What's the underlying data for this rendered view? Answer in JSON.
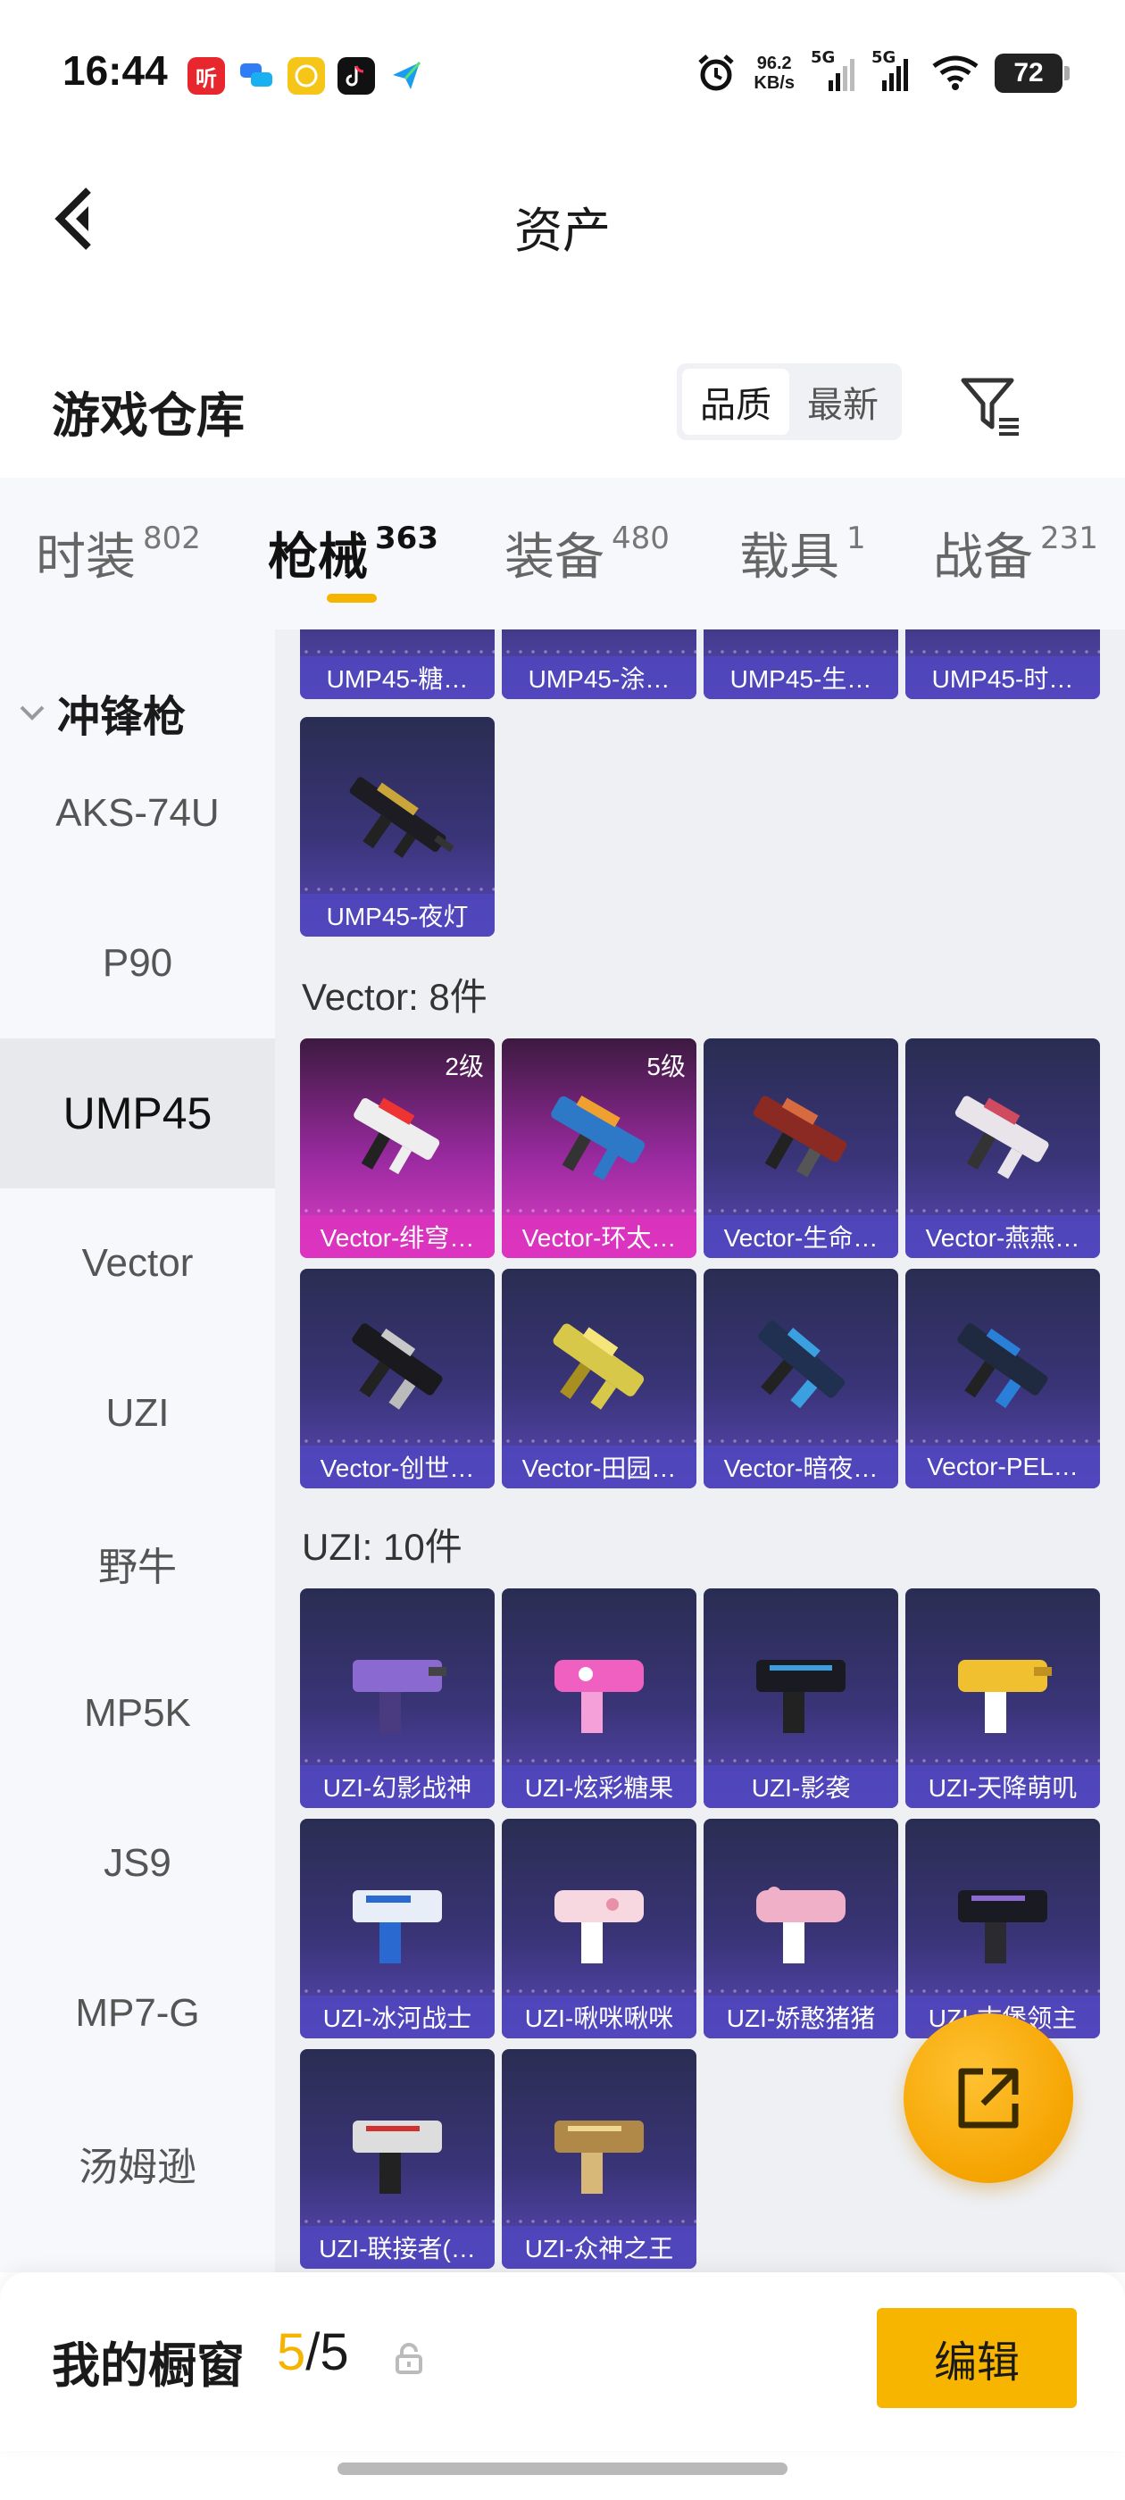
{
  "status_bar": {
    "time": "16:44",
    "net_speed_value": "96.2",
    "net_speed_unit": "KB/s",
    "sim1": "5G",
    "sim2": "5G",
    "battery": "72"
  },
  "nav": {
    "title": "资产"
  },
  "warehouse": {
    "title": "游戏仓库",
    "sort_options": [
      "品质",
      "最新"
    ],
    "active_sort": "品质"
  },
  "tabs": [
    {
      "label": "时装",
      "count": "802"
    },
    {
      "label": "枪械",
      "count": "363"
    },
    {
      "label": "装备",
      "count": "480"
    },
    {
      "label": "载具",
      "count": "1"
    },
    {
      "label": "战备",
      "count": "231"
    }
  ],
  "active_tab": "枪械",
  "sidebar": {
    "group": "冲锋枪",
    "items": [
      "AKS-74U",
      "P90",
      "UMP45",
      "Vector",
      "UZI",
      "野牛",
      "MP5K",
      "JS9",
      "MP7-G",
      "汤姆逊"
    ],
    "active": "UMP45"
  },
  "content": {
    "ump45_partial": [
      "UMP45-糖…",
      "UMP45-涂…",
      "UMP45-生…",
      "UMP45-时…"
    ],
    "ump45_last": "UMP45-夜灯",
    "vector_title": "Vector: 8件",
    "vector_items": [
      {
        "name": "Vector-绯穹…",
        "level": "2级"
      },
      {
        "name": "Vector-环太…",
        "level": "5级"
      },
      {
        "name": "Vector-生命…"
      },
      {
        "name": "Vector-燕燕…"
      },
      {
        "name": "Vector-创世…"
      },
      {
        "name": "Vector-田园…"
      },
      {
        "name": "Vector-暗夜…"
      },
      {
        "name": "Vector-PEL…"
      }
    ],
    "uzi_title": "UZI: 10件",
    "uzi_items": [
      "UZI-幻影战神",
      "UZI-炫彩糖果",
      "UZI-影袭",
      "UZI-天降萌叽",
      "UZI-冰河战士",
      "UZI-啾咪啾咪",
      "UZI-娇憨猪猪",
      "UZI-古堡领主",
      "UZI-联接者(…",
      "UZI-众神之王"
    ]
  },
  "showcase": {
    "label": "我的橱窗",
    "current": "5",
    "separator": "/",
    "max": "5",
    "edit_label": "编辑"
  },
  "colors": {
    "accent": "#f5b400",
    "card_purple": "#3a3478",
    "card_pink": "#e040c8"
  },
  "icons": {
    "back": "chevron-left-icon",
    "filter": "filter-icon",
    "fab": "share-export-icon",
    "lock": "lock-icon"
  }
}
